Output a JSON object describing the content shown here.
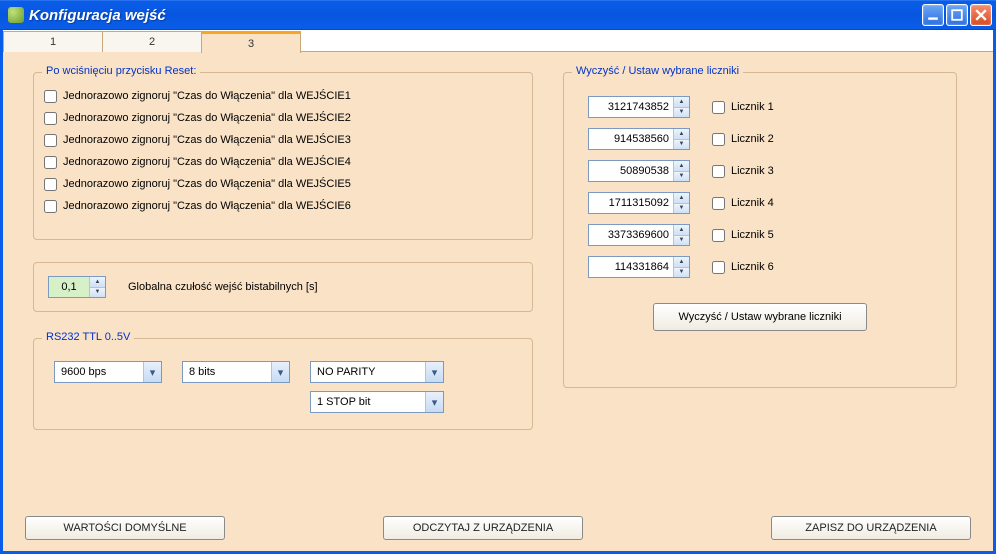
{
  "window": {
    "title": "Konfiguracja wejść"
  },
  "tabs": [
    "1",
    "2",
    "3"
  ],
  "active_tab": 2,
  "reset_group": {
    "legend": "Po wciśnięciu przycisku Reset:",
    "items": [
      "Jednorazowo zignoruj \"Czas do Włączenia\" dla WEJŚCIE1",
      "Jednorazowo zignoruj \"Czas do Włączenia\" dla WEJŚCIE2",
      "Jednorazowo zignoruj \"Czas do Włączenia\" dla WEJŚCIE3",
      "Jednorazowo zignoruj \"Czas do Włączenia\" dla WEJŚCIE4",
      "Jednorazowo zignoruj \"Czas do Włączenia\" dla WEJŚCIE5",
      "Jednorazowo zignoruj \"Czas do Włączenia\" dla WEJŚCIE6"
    ]
  },
  "sensitivity": {
    "value": "0,1",
    "label": "Globalna czułość wejść bistabilnych [s]"
  },
  "rs232": {
    "legend": "RS232 TTL 0..5V",
    "baud": "9600 bps",
    "bits": "8 bits",
    "parity": "NO PARITY",
    "stop": "1 STOP bit"
  },
  "counters": {
    "legend": "Wyczyść / Ustaw wybrane liczniki",
    "rows": [
      {
        "value": "3121743852",
        "label": "Licznik 1"
      },
      {
        "value": "914538560",
        "label": "Licznik 2"
      },
      {
        "value": "50890538",
        "label": "Licznik 3"
      },
      {
        "value": "1711315092",
        "label": "Licznik 4"
      },
      {
        "value": "3373369600",
        "label": "Licznik 5"
      },
      {
        "value": "114331864",
        "label": "Licznik 6"
      }
    ],
    "button": "Wyczyść / Ustaw wybrane liczniki"
  },
  "footer": {
    "defaults": "WARTOŚCI DOMYŚLNE",
    "read": "ODCZYTAJ Z URZĄDZENIA",
    "save": "ZAPISZ DO URZĄDZENIA"
  }
}
